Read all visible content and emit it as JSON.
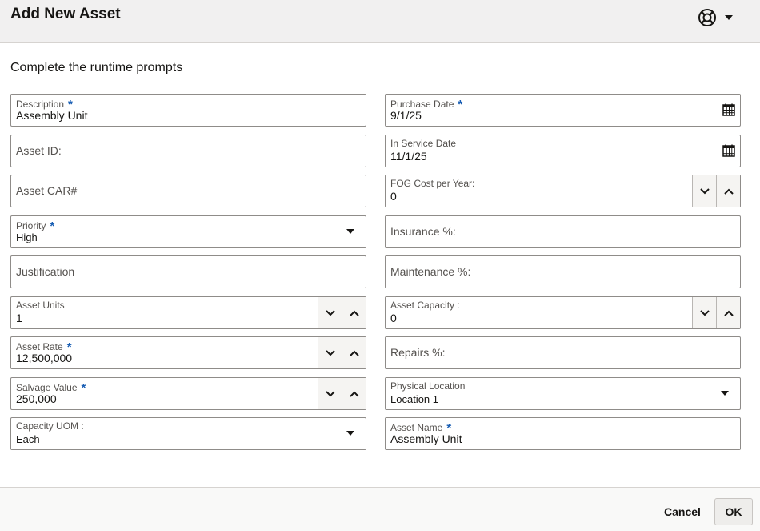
{
  "dialog": {
    "title": "Add New Asset",
    "subtitle": "Complete the runtime prompts"
  },
  "fields": {
    "description": {
      "label": "Description",
      "value": "Assembly Unit"
    },
    "asset_id": {
      "placeholder": "Asset ID:"
    },
    "asset_car": {
      "placeholder": "Asset CAR#"
    },
    "priority": {
      "label": "Priority",
      "value": "High"
    },
    "justification": {
      "placeholder": "Justification"
    },
    "asset_units": {
      "label": "Asset Units",
      "value": "1"
    },
    "asset_rate": {
      "label": "Asset Rate",
      "value": "12,500,000"
    },
    "salvage_value": {
      "label": "Salvage Value",
      "value": "250,000"
    },
    "capacity_uom": {
      "label": "Capacity UOM :",
      "value": "Each"
    },
    "purchase_date": {
      "label": "Purchase Date",
      "value": "9/1/25"
    },
    "in_service_date": {
      "label": "In Service Date",
      "value": "11/1/25"
    },
    "fog_cost": {
      "label": "FOG Cost per Year:",
      "value": "0"
    },
    "insurance": {
      "placeholder": "Insurance %:"
    },
    "maintenance": {
      "placeholder": "Maintenance %:"
    },
    "asset_capacity": {
      "label": "Asset Capacity :",
      "value": "0"
    },
    "repairs": {
      "placeholder": "Repairs %:"
    },
    "physical_location": {
      "label": "Physical Location",
      "value": "Location 1"
    },
    "asset_name": {
      "label": "Asset Name",
      "value": "Assembly Unit"
    }
  },
  "required_marker": "*",
  "footer": {
    "cancel_label": "Cancel",
    "ok_label": "OK"
  },
  "icons": {
    "help": "lifebuoy-icon",
    "calendar": "calendar-icon",
    "dropdown": "caret-down-icon",
    "decrement": "chevron-down-icon",
    "increment": "chevron-up-icon"
  },
  "colors": {
    "required": "#1a5fb4",
    "header_bg": "#f1f0f0",
    "border": "#8f8c89"
  }
}
